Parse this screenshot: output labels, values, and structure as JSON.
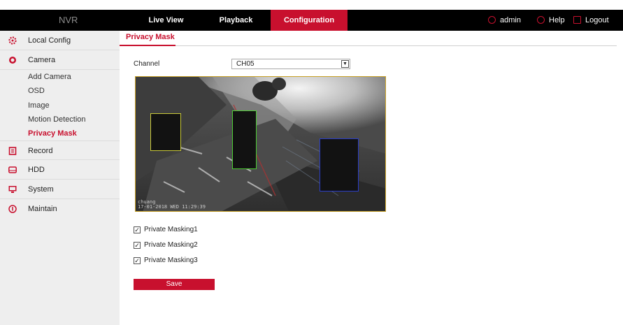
{
  "header": {
    "logo": "NVR",
    "nav": [
      {
        "label": "Live View",
        "active": false
      },
      {
        "label": "Playback",
        "active": false
      },
      {
        "label": "Configuration",
        "active": true
      }
    ],
    "user": "admin",
    "help": "Help",
    "logout": "Logout",
    "accent": "#c8102e"
  },
  "sidebar": {
    "items": [
      {
        "label": "Local Config",
        "icon": "gear-icon"
      },
      {
        "label": "Camera",
        "icon": "camera-icon"
      },
      {
        "label": "Record",
        "icon": "record-icon"
      },
      {
        "label": "HDD",
        "icon": "hdd-icon"
      },
      {
        "label": "System",
        "icon": "monitor-icon"
      },
      {
        "label": "Maintain",
        "icon": "info-icon"
      }
    ],
    "camera_sub": [
      {
        "label": "Add Camera",
        "active": false
      },
      {
        "label": "OSD",
        "active": false
      },
      {
        "label": "Image",
        "active": false
      },
      {
        "label": "Motion Detection",
        "active": false
      },
      {
        "label": "Privacy Mask",
        "active": true
      }
    ]
  },
  "main": {
    "tab": "Privacy Mask",
    "channel_label": "Channel",
    "channel_value": "CH05",
    "osd_line1": "chuang",
    "osd_line2": "17-01-2018  WED  11:29:39",
    "masks": [
      {
        "label": "Private Masking1",
        "checked": true,
        "color": "#c9c93a"
      },
      {
        "label": "Private Masking2",
        "checked": true,
        "color": "#4ccc33"
      },
      {
        "label": "Private Masking3",
        "checked": true,
        "color": "#2a3dc8"
      }
    ],
    "save_label": "Save"
  }
}
